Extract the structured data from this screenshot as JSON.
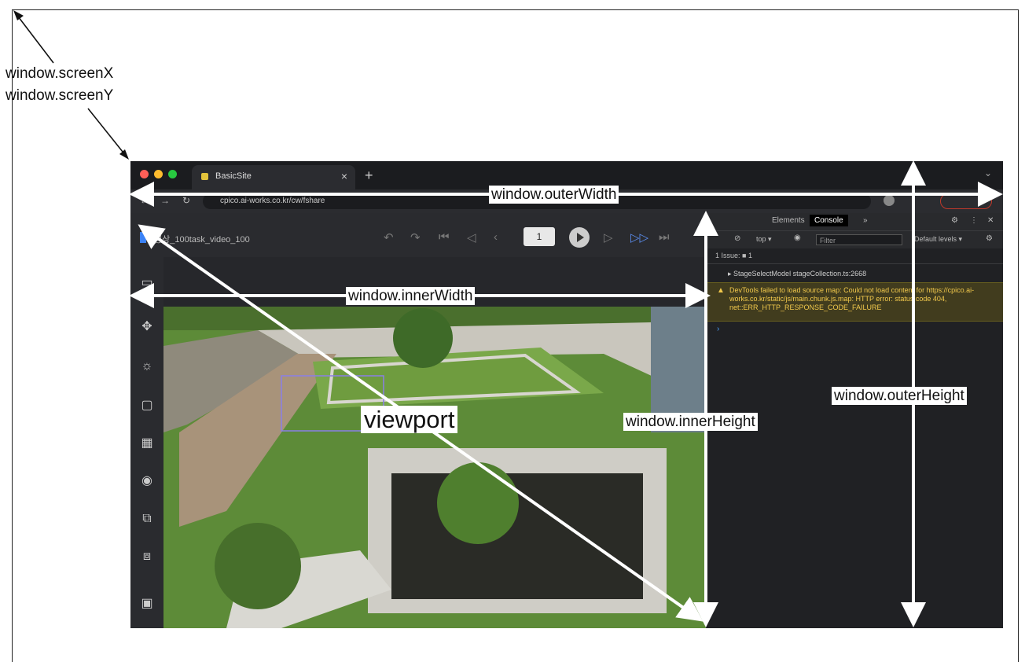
{
  "annotations": {
    "screen_xy": [
      "window.screenX",
      "window.screenY"
    ],
    "outer_width": "window.outerWidth",
    "inner_width": "window.innerWidth",
    "viewport": "viewport",
    "inner_height": "window.innerHeight",
    "outer_height": "window.outerHeight"
  },
  "browser": {
    "tab_title": "BasicSite",
    "tab_close": "×",
    "tab_new": "+",
    "url": "cpico.ai-works.co.kr/cw/fshare",
    "app_title": "영상_100task_video_100",
    "frame_number": "1",
    "traffic_lights": [
      "#ff5f57",
      "#febc2e",
      "#28c840"
    ]
  },
  "devtools": {
    "tabs": [
      "Elements",
      "Console",
      "»"
    ],
    "active_tab": "Console",
    "context": "top ▾",
    "filter_placeholder": "Filter",
    "levels": "Default levels ▾",
    "issues": "1 Issue: ■ 1",
    "log_line": "▸ StageSelectModel   stageCollection.ts:2668",
    "warning": "DevTools failed to load source map: Could not load content for https://cpico.ai-works.co.kr/static/js/main.chunk.js.map: HTTP error: status code 404, net::ERR_HTTP_RESPONSE_CODE_FAILURE",
    "prompt": "›"
  },
  "colors": {
    "arrow": "#ffffff",
    "browser_bg": "#1f2023",
    "warning_bg": "#413c1e",
    "bbox": "#8a7fe6"
  }
}
